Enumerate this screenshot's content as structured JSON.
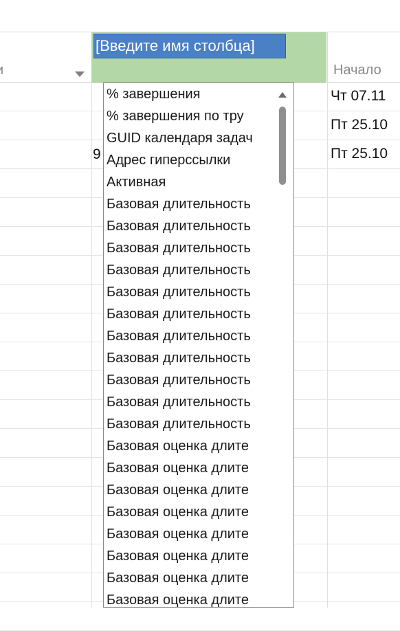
{
  "header": {
    "names_label": "и",
    "new_column_input": "[Введите имя столбца]",
    "start_label": "Начало"
  },
  "rows": [
    {
      "start": "Чт 07.11",
      "num": ""
    },
    {
      "start": "Пт 25.10",
      "num": ""
    },
    {
      "start": "Пт 25.10",
      "num": "9"
    }
  ],
  "field_list": [
    "% завершения",
    "% завершения по тру",
    "GUID календаря задач",
    "Адрес гиперссылки",
    "Активная",
    "Базовая длительность",
    "Базовая длительность",
    "Базовая длительность",
    "Базовая длительность",
    "Базовая длительность",
    "Базовая длительность",
    "Базовая длительность",
    "Базовая длительность",
    "Базовая длительность",
    "Базовая длительность",
    "Базовая длительность",
    "Базовая оценка длите",
    "Базовая оценка длите",
    "Базовая оценка длите",
    "Базовая оценка длите",
    "Базовая оценка длите",
    "Базовая оценка длите",
    "Базовая оценка длите",
    "Базовая оценка длите"
  ],
  "icons": {
    "header_dropdown": "chevron-down-icon",
    "scroll_up": "scroll-up-arrow-icon"
  }
}
